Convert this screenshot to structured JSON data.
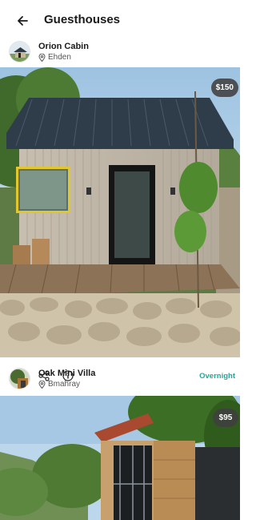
{
  "header": {
    "title": "Guesthouses",
    "back_icon": "arrow-left-icon"
  },
  "listings": [
    {
      "name": "Orion Cabin",
      "location": "Ehden",
      "price": "$150",
      "stay_type": "Overnight",
      "stay_type_color": "#26a69a",
      "icons": [
        "heart-icon",
        "share-icon",
        "info-icon"
      ]
    },
    {
      "name": "Oak Mini Villa",
      "location": "Bmahray",
      "price": "$95"
    }
  ],
  "colors": {
    "accent": "#26a69a",
    "badge_bg": "#404040"
  }
}
